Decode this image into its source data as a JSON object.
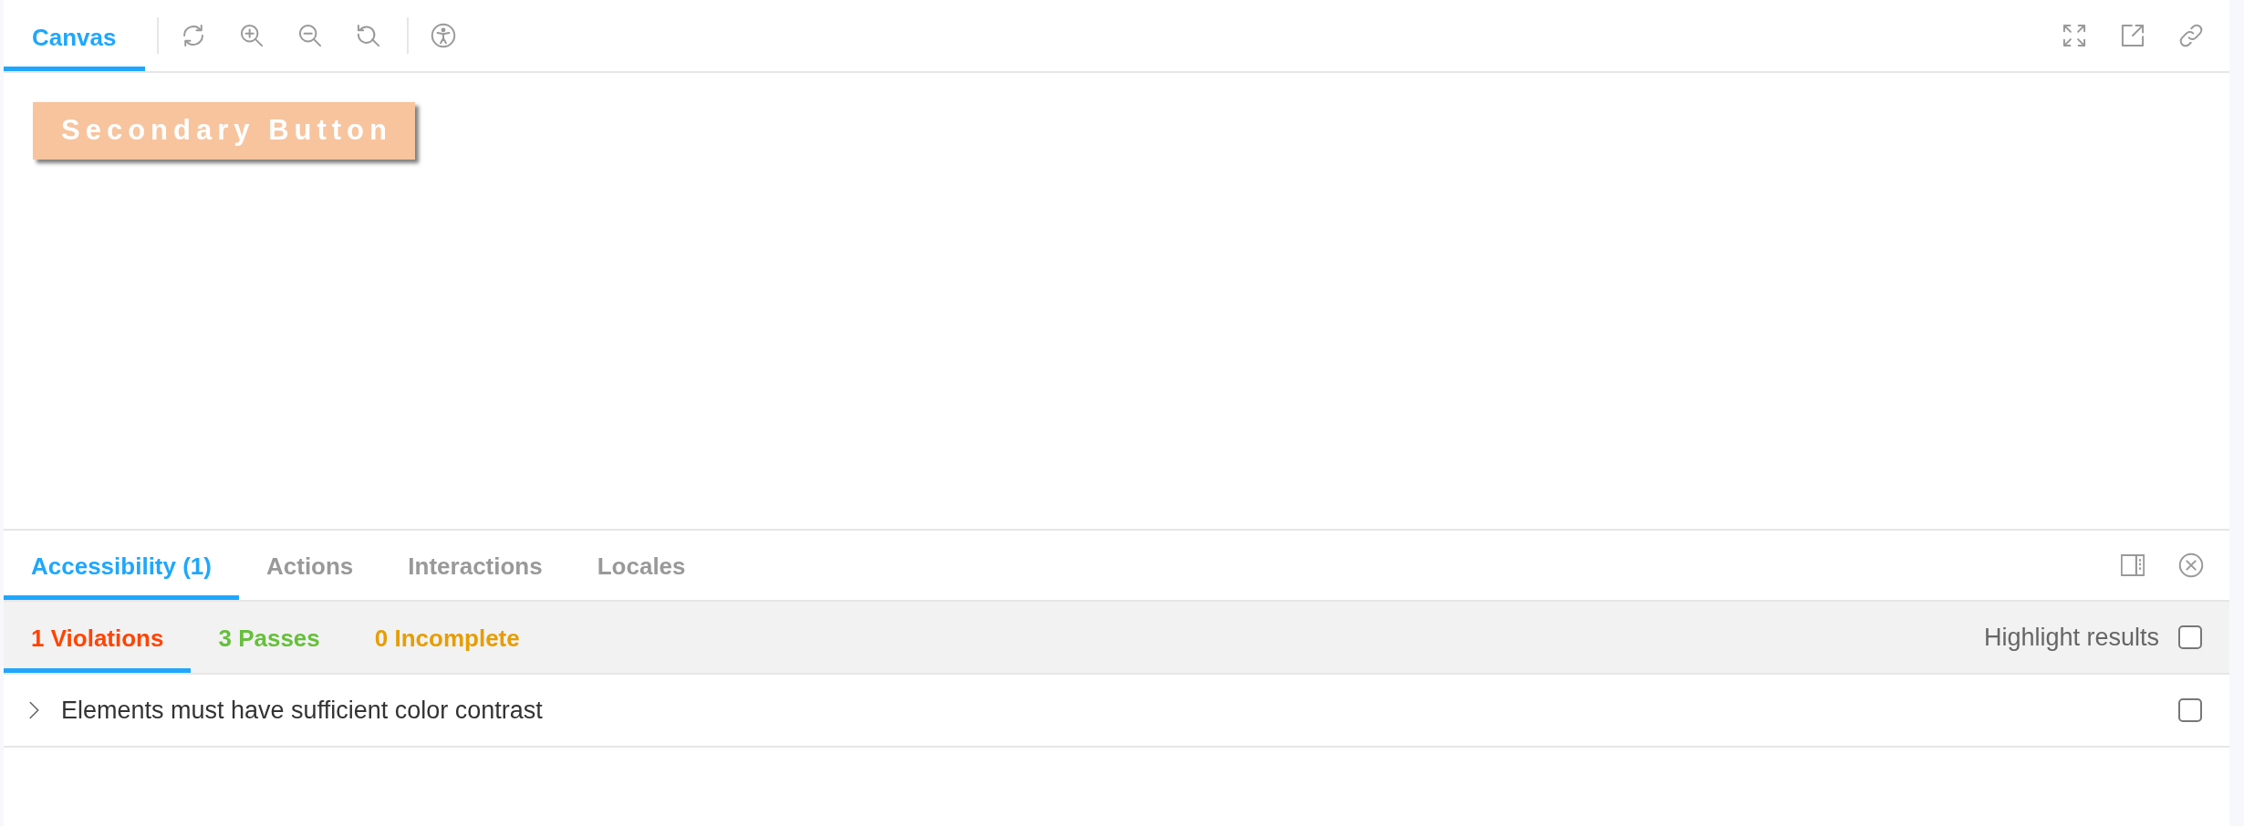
{
  "toolbar": {
    "tabs": [
      {
        "label": "Canvas",
        "selected": true
      }
    ]
  },
  "canvas": {
    "button": {
      "label": "Secondary Button"
    }
  },
  "addons": {
    "tabs": [
      {
        "label": "Accessibility (1)",
        "selected": true
      },
      {
        "label": "Actions",
        "selected": false
      },
      {
        "label": "Interactions",
        "selected": false
      },
      {
        "label": "Locales",
        "selected": false
      }
    ]
  },
  "results": {
    "tabs": [
      {
        "label": "1 Violations",
        "selected": true,
        "color": "#ff4400"
      },
      {
        "label": "3 Passes",
        "selected": false,
        "color": "#66bf3c"
      },
      {
        "label": "0 Incomplete",
        "selected": false,
        "color": "#e69d00"
      }
    ],
    "highlight": {
      "label": "Highlight results",
      "checked": false
    }
  },
  "rules": [
    {
      "label": "Elements must have sufficient color contrast",
      "expanded": false,
      "checked": false
    }
  ]
}
